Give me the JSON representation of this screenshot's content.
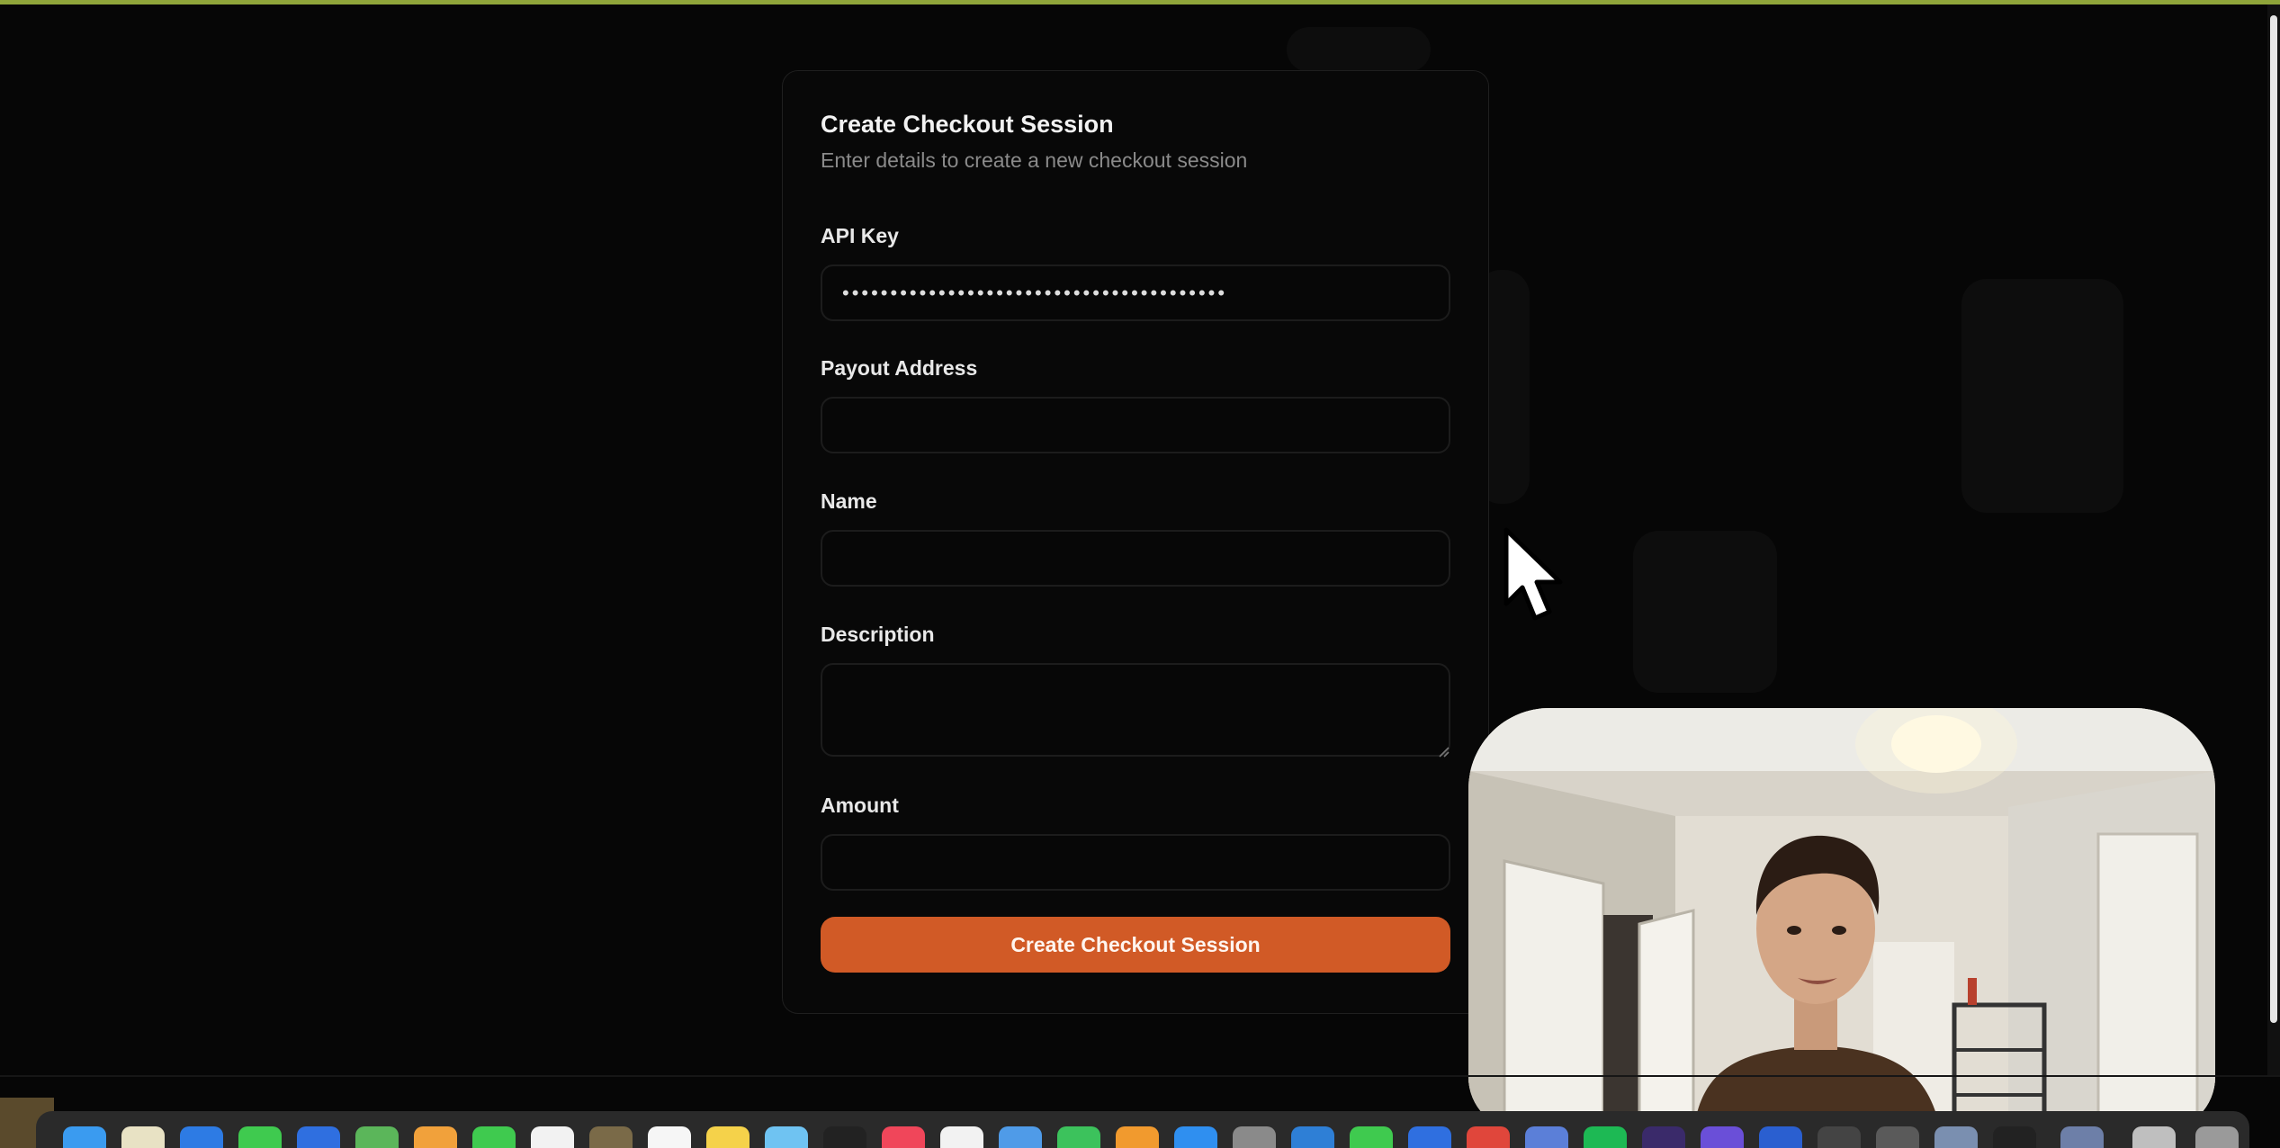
{
  "form": {
    "title": "Create Checkout Session",
    "subtitle": "Enter details to create a new checkout session",
    "fields": {
      "api_key": {
        "label": "API Key",
        "value": "••••••••••••••••••••••••••••••••••••••••"
      },
      "payout_address": {
        "label": "Payout Address",
        "value": ""
      },
      "name": {
        "label": "Name",
        "value": ""
      },
      "description": {
        "label": "Description",
        "value": ""
      },
      "amount": {
        "label": "Amount",
        "value": ""
      }
    },
    "submit_label": "Create Checkout Session"
  },
  "colors": {
    "background": "#060606",
    "accent": "#d15a26",
    "top_bar": "#8fa53a"
  },
  "icons": {
    "cursor": "mouse-pointer-icon"
  }
}
